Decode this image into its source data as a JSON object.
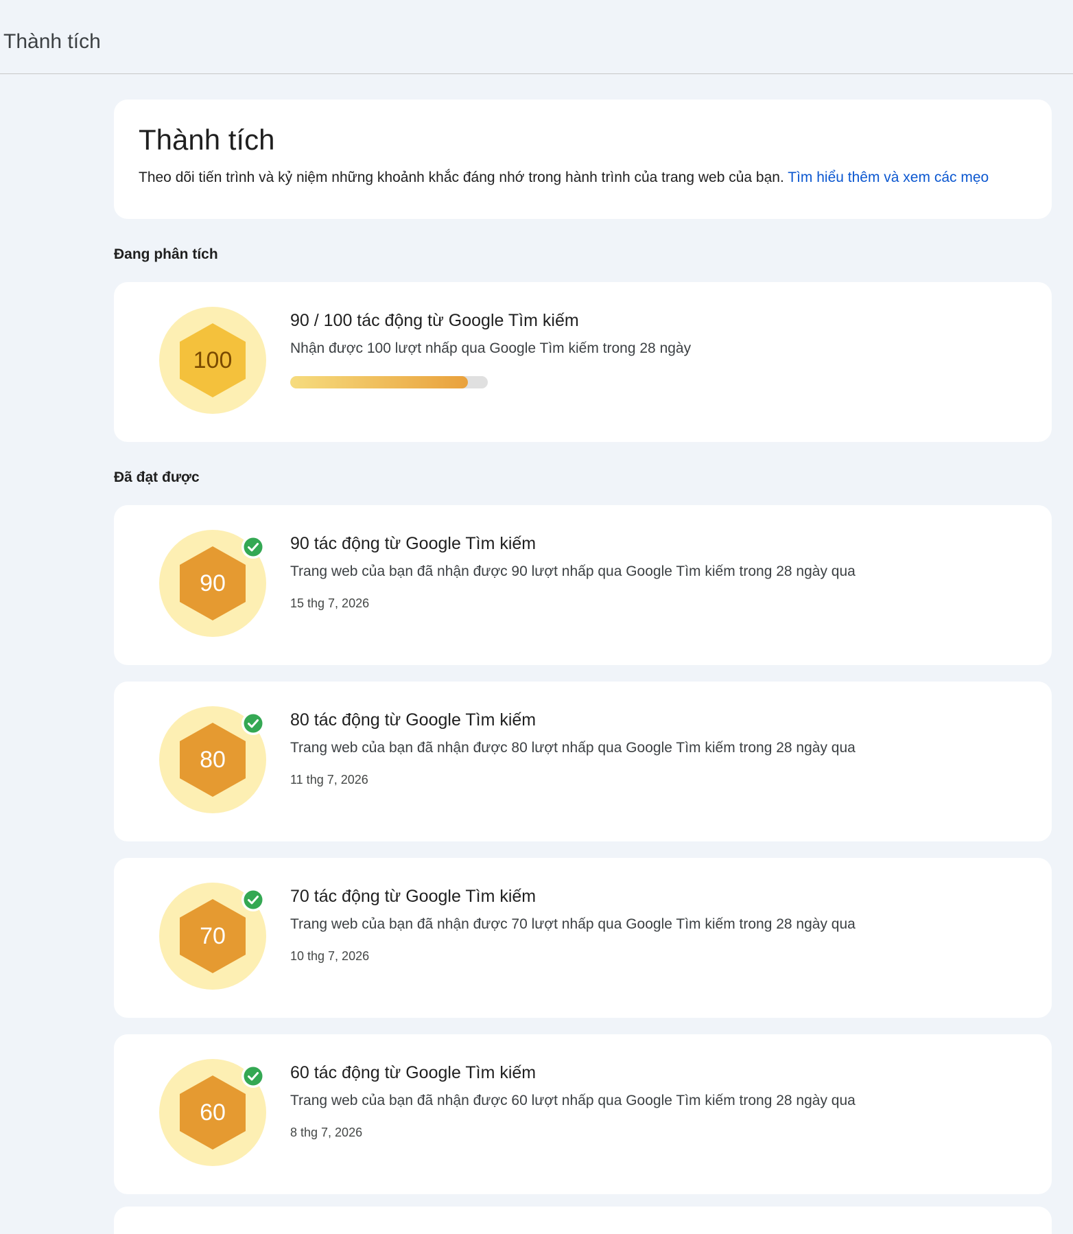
{
  "header": {
    "title": "Thành tích"
  },
  "intro": {
    "title": "Thành tích",
    "description": "Theo dõi tiến trình và kỷ niệm những khoảnh khắc đáng nhớ trong hành trình của trang web của bạn.",
    "link_text": "Tìm hiểu thêm và xem các mẹo"
  },
  "analyzing": {
    "section_label": "Đang phân tích",
    "badge_number": "100",
    "title": "90 / 100 tác động từ Google Tìm kiếm",
    "description": "Nhận được 100 lượt nhấp qua Google Tìm kiếm trong 28 ngày",
    "progress_current": 90,
    "progress_target": 100
  },
  "achieved": {
    "section_label": "Đã đạt được",
    "items": [
      {
        "badge_number": "90",
        "title": "90 tác động từ Google Tìm kiếm",
        "description": "Trang web của bạn đã nhận được 90 lượt nhấp qua Google Tìm kiếm trong 28 ngày qua",
        "date": "15 thg 7, 2026"
      },
      {
        "badge_number": "80",
        "title": "80 tác động từ Google Tìm kiếm",
        "description": "Trang web của bạn đã nhận được 80 lượt nhấp qua Google Tìm kiếm trong 28 ngày qua",
        "date": "11 thg 7, 2026"
      },
      {
        "badge_number": "70",
        "title": "70 tác động từ Google Tìm kiếm",
        "description": "Trang web của bạn đã nhận được 70 lượt nhấp qua Google Tìm kiếm trong 28 ngày qua",
        "date": "10 thg 7, 2026"
      },
      {
        "badge_number": "60",
        "title": "60 tác động từ Google Tìm kiếm",
        "description": "Trang web của bạn đã nhận được 60 lượt nhấp qua Google Tìm kiếm trong 28 ngày qua",
        "date": "8 thg 7, 2026"
      }
    ]
  },
  "colors": {
    "page_background": "#f0f4f9",
    "card_background": "#ffffff",
    "badge_circle": "#fdefb3",
    "hex_pending": "#f4c13c",
    "hex_achieved": "#e59a31",
    "check_green": "#34a853",
    "link_blue": "#0b57d0"
  },
  "icons": {
    "achieved_badge": "hexagon-badge-icon",
    "pending_badge": "hexagon-badge-icon",
    "check": "check-circle-icon"
  }
}
